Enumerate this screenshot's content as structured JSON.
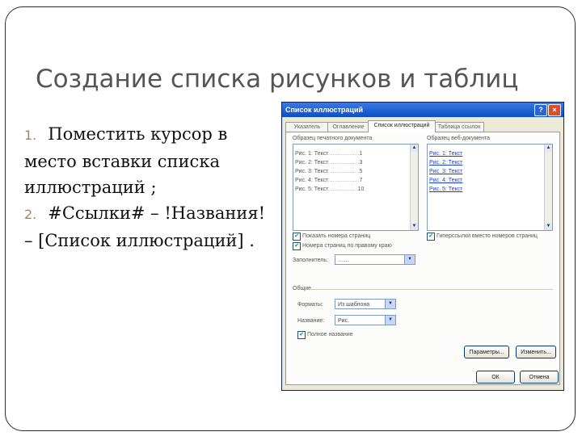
{
  "slide": {
    "title": "Создание списка рисунков и таблиц",
    "steps": [
      {
        "num": "1.",
        "text": "Поместить курсор в место вставки списка иллюстраций ;"
      },
      {
        "num": "2.",
        "text": "#Ссылки# – !Названия! – [Список иллюстраций] ."
      }
    ]
  },
  "dialog": {
    "title": "Список иллюстраций",
    "help_icon": "?",
    "close_icon": "×",
    "tabs": [
      "Указатель",
      "Оглавление",
      "Список иллюстраций",
      "Таблица ссылок"
    ],
    "print_preview_label": "Образец печатного документа",
    "web_preview_label": "Образец веб-документа",
    "print_preview_rows": [
      {
        "text": "Рис. 1: Текст",
        "page": "1"
      },
      {
        "text": "Рис. 2: Текст",
        "page": "3"
      },
      {
        "text": "Рис. 3: Текст",
        "page": "5"
      },
      {
        "text": "Рис. 4: Текст",
        "page": "7"
      },
      {
        "text": "Рис. 5: Текст",
        "page": "10"
      }
    ],
    "web_preview_rows": [
      "Рис. 1: Текст",
      "Рис. 2: Текст",
      "Рис. 3: Текст",
      "Рис. 4: Текст",
      "Рис. 5: Текст"
    ],
    "show_page_numbers_label": "Показать номера страниц",
    "right_align_label": "Номера страниц по правому краю",
    "hyperlinks_label": "Гиперссылки вместо номеров страниц",
    "tab_leader_label": "Заполнитель:",
    "tab_leader_value": ".......",
    "general_label": "Общие",
    "formats_label": "Форматы:",
    "formats_value": "Из шаблона",
    "caption_label": "Название:",
    "caption_value": "Рис.",
    "full_caption_label": "Полное название",
    "options_button": "Параметры...",
    "modify_button": "Изменить...",
    "ok_button": "ОК",
    "cancel_button": "Отмена"
  }
}
